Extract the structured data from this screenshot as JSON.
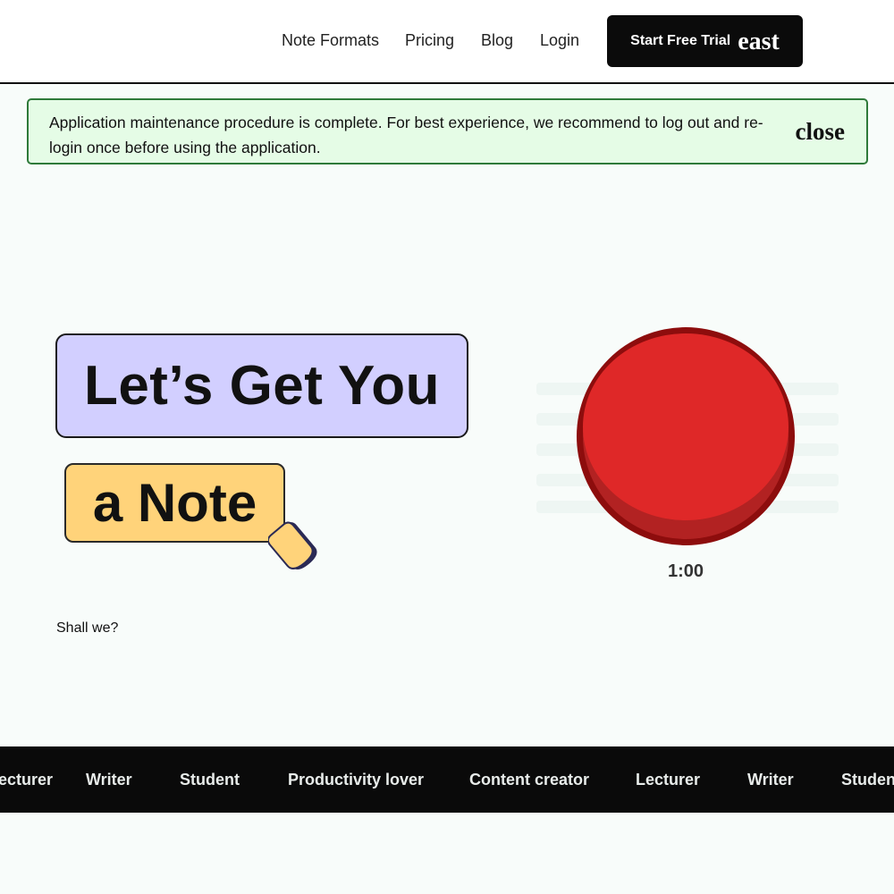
{
  "header": {
    "nav": [
      {
        "label": "Note Formats"
      },
      {
        "label": "Pricing"
      },
      {
        "label": "Blog"
      },
      {
        "label": "Login"
      }
    ],
    "cta": {
      "label": "Start Free Trial",
      "icon_text": "east",
      "icon": "arrow-right-icon"
    }
  },
  "notice": {
    "message": "Application maintenance procedure is complete. For best experience, we recommend to log out and re-login once before using the application.",
    "close_label": "close"
  },
  "hero": {
    "line1": "Let’s Get You",
    "line2": "a Note",
    "subline": "Shall we?",
    "colors": {
      "box1": "#d2cfff",
      "box2": "#ffd37a"
    }
  },
  "recorder": {
    "timer": "1:00",
    "color": "#df2828"
  },
  "marquee": {
    "items": [
      "Lecturer",
      "Writer",
      "Student",
      "Productivity lover",
      "Content creator",
      "Lecturer",
      "Writer",
      "Student"
    ]
  }
}
